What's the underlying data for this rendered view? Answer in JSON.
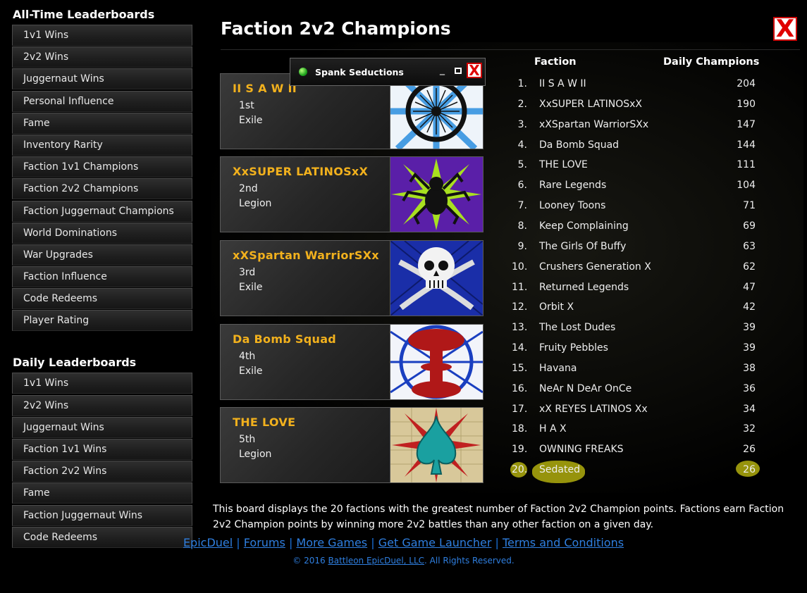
{
  "sidebar": {
    "all_time_title": "All-Time Leaderboards",
    "all_time_items": [
      "1v1 Wins",
      "2v2 Wins",
      "Juggernaut Wins",
      "Personal Influence",
      "Fame",
      "Inventory Rarity",
      "Faction 1v1 Champions",
      "Faction 2v2 Champions",
      "Faction Juggernaut Champions",
      "World Dominations",
      "War Upgrades",
      "Faction Influence",
      "Code Redeems",
      "Player Rating"
    ],
    "daily_title": "Daily Leaderboards",
    "daily_items": [
      "1v1 Wins",
      "2v2 Wins",
      "Juggernaut Wins",
      "Faction 1v1 Wins",
      "Faction 2v2 Wins",
      "Fame",
      "Faction Juggernaut Wins",
      "Code Redeems"
    ]
  },
  "header": {
    "title": "Faction 2v2 Champions",
    "close_glyph": "X"
  },
  "popup": {
    "title": "Spank Seductions",
    "minimize_glyph": "_",
    "close_glyph": "X"
  },
  "champions": [
    {
      "name": "II S A W II",
      "rank": "1st",
      "alignment": "Exile",
      "emblem": "blue-wheel-emblem"
    },
    {
      "name": "XxSUPER LATINOSxX",
      "rank": "2nd",
      "alignment": "Legion",
      "emblem": "spider-emblem"
    },
    {
      "name": "xXSpartan WarriorSXx",
      "rank": "3rd",
      "alignment": "Exile",
      "emblem": "skull-crossed-swords-emblem"
    },
    {
      "name": "Da Bomb Squad",
      "rank": "4th",
      "alignment": "Exile",
      "emblem": "mushroom-cloud-emblem"
    },
    {
      "name": "THE LOVE",
      "rank": "5th",
      "alignment": "Legion",
      "emblem": "teal-spade-emblem"
    }
  ],
  "table": {
    "col_faction": "Faction",
    "col_champions": "Daily Champions",
    "rows": [
      {
        "num": "1.",
        "name": "II S A W II",
        "score": "204"
      },
      {
        "num": "2.",
        "name": "XxSUPER LATINOSxX",
        "score": "190"
      },
      {
        "num": "3.",
        "name": "xXSpartan WarriorSXx",
        "score": "147"
      },
      {
        "num": "4.",
        "name": "Da Bomb Squad",
        "score": "144"
      },
      {
        "num": "5.",
        "name": "THE LOVE",
        "score": "111"
      },
      {
        "num": "6.",
        "name": "Rare Legends",
        "score": "104"
      },
      {
        "num": "7.",
        "name": "Looney Toons",
        "score": "71"
      },
      {
        "num": "8.",
        "name": "Keep Complaining",
        "score": "69"
      },
      {
        "num": "9.",
        "name": "The Girls Of Buffy",
        "score": "63"
      },
      {
        "num": "10.",
        "name": "Crushers Generation X",
        "score": "62"
      },
      {
        "num": "11.",
        "name": "Returned Legends",
        "score": "47"
      },
      {
        "num": "12.",
        "name": "Orbit X",
        "score": "42"
      },
      {
        "num": "13.",
        "name": "The Lost Dudes",
        "score": "39"
      },
      {
        "num": "14.",
        "name": "Fruity Pebbles",
        "score": "39"
      },
      {
        "num": "15.",
        "name": "Havana",
        "score": "38"
      },
      {
        "num": "16.",
        "name": "NeAr N DeAr OnCe",
        "score": "36"
      },
      {
        "num": "17.",
        "name": "xX REYES LATINOS Xx",
        "score": "34"
      },
      {
        "num": "18.",
        "name": "H A X",
        "score": "32"
      },
      {
        "num": "19.",
        "name": "OWNING FREAKS",
        "score": "26"
      },
      {
        "num": "20.",
        "name": "Sedated",
        "score": "26"
      }
    ]
  },
  "description": "This board displays the 20 factions with the greatest number of Faction 2v2 Champion points.  Factions earn Faction 2v2 Champion points by winning more 2v2 battles than any other faction on a given day.",
  "footer": {
    "links": [
      "EpicDuel",
      "Forums",
      "More Games",
      "Get Game Launcher",
      "Terms and Conditions"
    ],
    "separator": "|",
    "copyright_prefix": "© 2016",
    "copyright_link": "Battleon EpicDuel, LLC",
    "copyright_suffix": ". All Rights Reserved."
  },
  "colors": {
    "accent_gold": "#f2b11d",
    "link_blue": "#2f7fe0",
    "highlight": "#c8c410",
    "close_red": "#e00000"
  }
}
